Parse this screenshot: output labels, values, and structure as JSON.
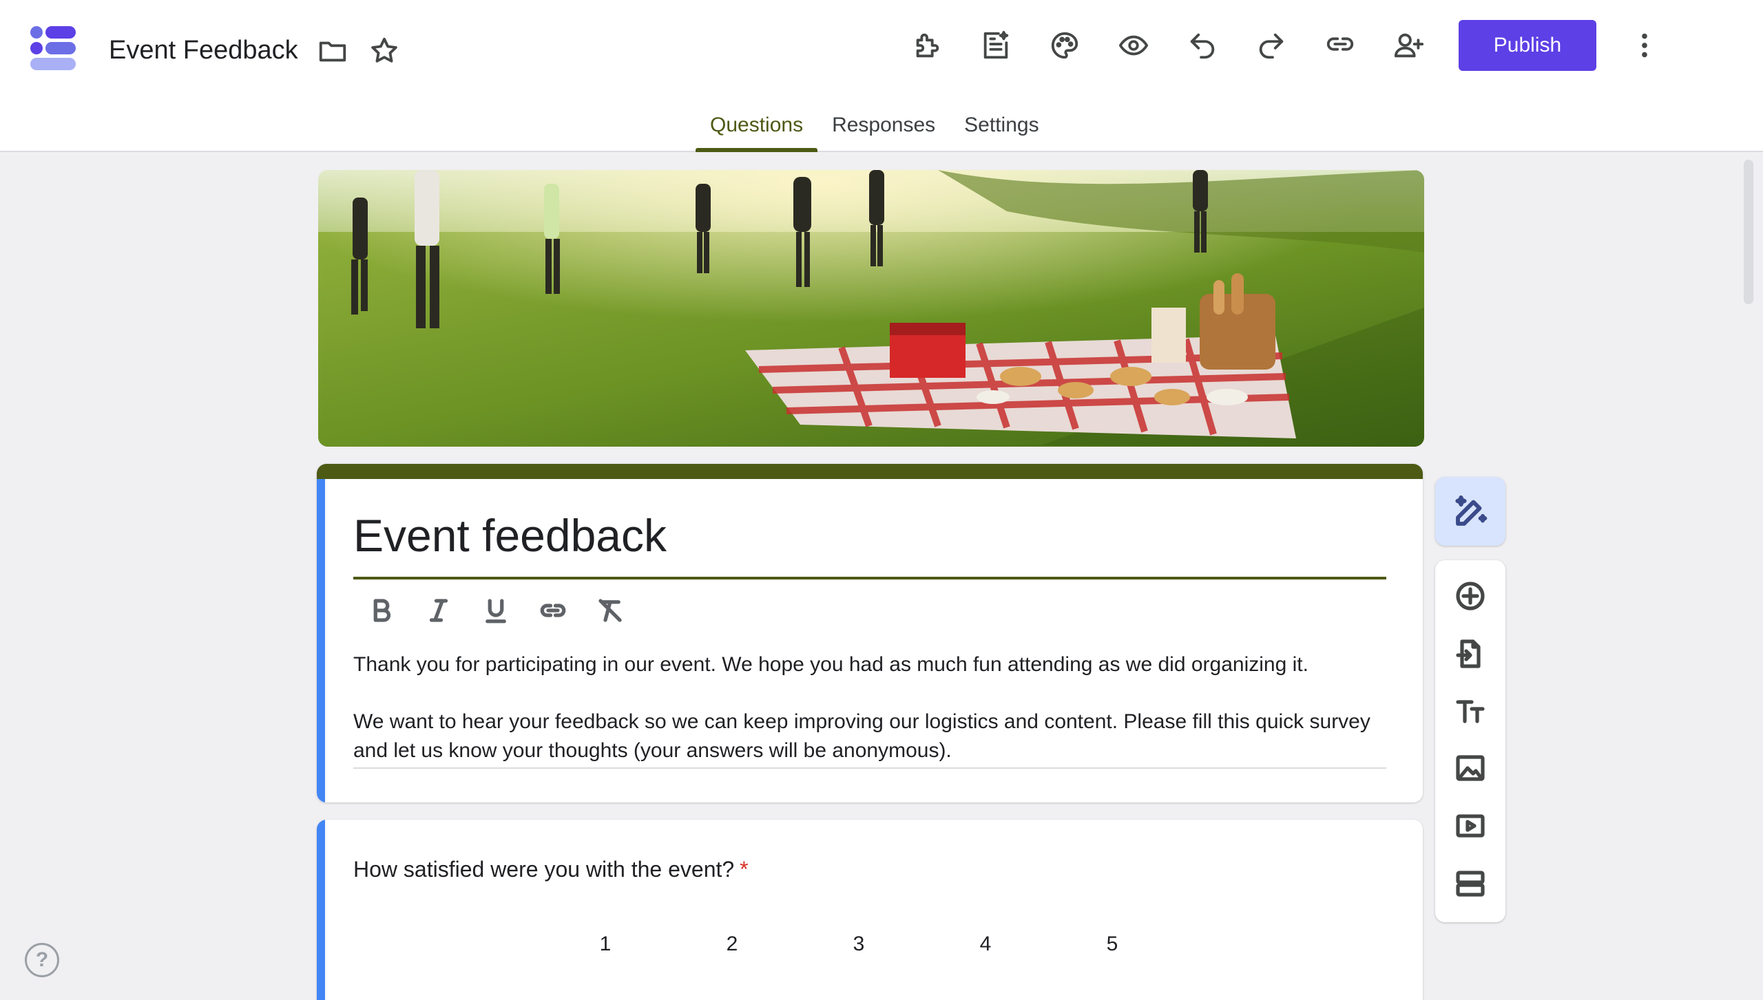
{
  "header": {
    "doc_title": "Event Feedback",
    "publish_label": "Publish",
    "icons": [
      "folder-icon",
      "star-icon",
      "addons-icon",
      "ai-summary-icon",
      "palette-icon",
      "preview-icon",
      "undo-icon",
      "redo-icon",
      "link-icon",
      "add-collaborator-icon",
      "more-vert-icon"
    ]
  },
  "tabs": [
    {
      "label": "Questions",
      "active": true
    },
    {
      "label": "Responses",
      "active": false
    },
    {
      "label": "Settings",
      "active": false
    }
  ],
  "form": {
    "title": "Event feedback",
    "description": [
      "Thank you for participating in our event. We hope you had as much fun attending as we did organizing it.",
      "We want to hear your feedback so we can keep improving our logistics and content. Please fill this quick survey and let us know your thoughts (your answers will be anonymous)."
    ],
    "format_tools": [
      "bold-icon",
      "italic-icon",
      "underline-icon",
      "link-icon",
      "clear-format-icon"
    ]
  },
  "question": {
    "text": "How satisfied were you with the event?",
    "required_mark": "*",
    "scale": [
      "1",
      "2",
      "3",
      "4",
      "5"
    ]
  },
  "side_toolbar": [
    "ai-edit-icon",
    "add-question-icon",
    "import-questions-icon",
    "add-title-icon",
    "add-image-icon",
    "add-video-icon",
    "add-section-icon"
  ],
  "help_label": "?",
  "colors": {
    "accent": "#4d5a14",
    "publish": "#5d40e6",
    "card_highlight": "#4285f4",
    "background": "#f0eff2"
  }
}
